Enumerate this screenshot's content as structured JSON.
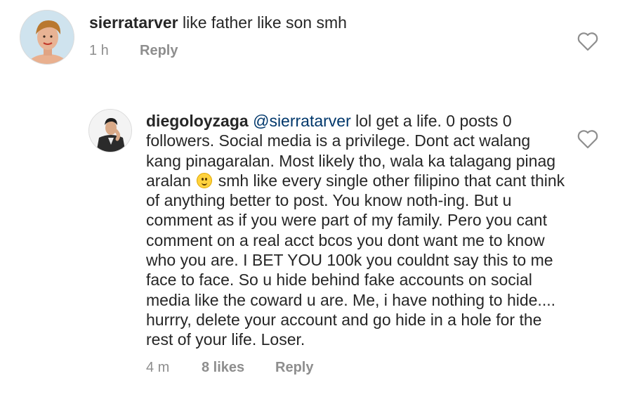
{
  "comments": [
    {
      "username": "sierratarver",
      "mention": "",
      "text": "like father like son smh",
      "time": "1 h",
      "likes": "",
      "reply_label": "Reply"
    },
    {
      "username": "diegoloyzaga",
      "mention": "@sierratarver",
      "text_before_emoji": "lol get a life. 0 posts 0 followers. Social media is a privilege. Dont act walang kang pinagaralan. Most likely tho, wala ka talagang pinag aralan",
      "emoji": "slightly-smiling-face-icon",
      "text_after_emoji": "smh like every single other filipino that cant think of anything better to post. You know noth-ing. But u comment as if you were part of my family. Pero you cant comment on a real acct bcos you dont want me to know who you are. I BET YOU 100k you couldnt say this to me face to face. So u hide behind fake accounts on social media like the coward u are. Me, i have nothing to hide.... hurrry, delete your account and go hide in a hole for the rest of your life. Loser.",
      "time": "4 m",
      "likes": "8 likes",
      "reply_label": "Reply"
    }
  ],
  "colors": {
    "text": "#262626",
    "meta": "#8e8e8e",
    "mention": "#00376b",
    "heart_stroke": "#8e8e8e"
  },
  "icons": {
    "like": "heart-outline-icon"
  }
}
